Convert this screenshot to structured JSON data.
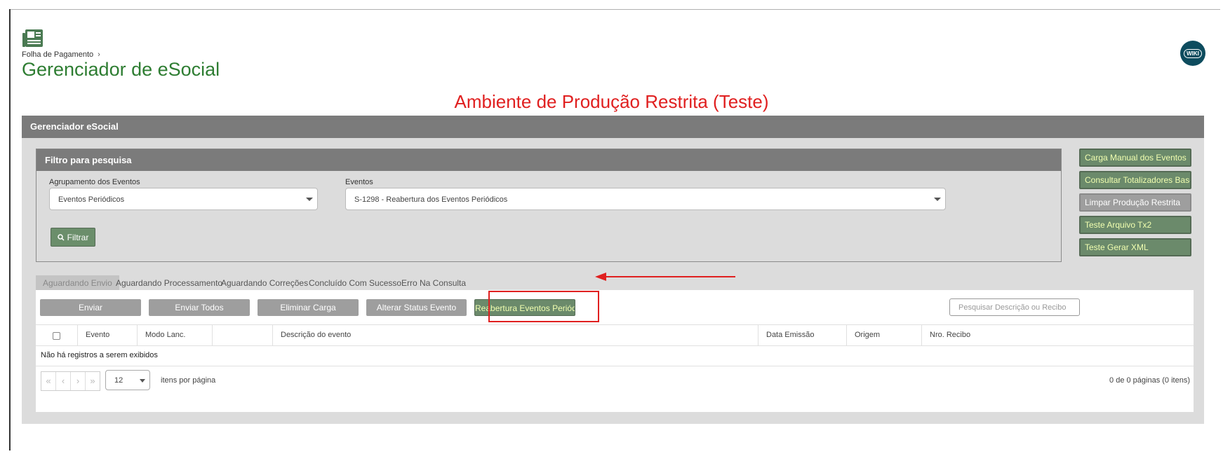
{
  "breadcrumb": {
    "parent": "Folha de Pagamento",
    "sep": "›"
  },
  "page_title": "Gerenciador de eSocial",
  "wiki_label": "WIKI",
  "environment_banner": "Ambiente de Produção Restrita (Teste)",
  "panel_title": "Gerenciador eSocial",
  "filter": {
    "title": "Filtro para pesquisa",
    "group_label": "Agrupamento dos Eventos",
    "group_value": "Eventos Periódicos",
    "events_label": "Eventos",
    "events_value": "S-1298 - Reabertura dos Eventos Periódicos",
    "filter_button": "Filtrar"
  },
  "side_buttons": [
    "Carga Manual dos Eventos",
    "Consultar Totalizadores Base",
    "Limpar Produção Restrita",
    "Teste Arquivo Tx2",
    "Teste Gerar XML"
  ],
  "tabs": [
    "Aguardando Envio",
    "Aguardando Processamento",
    "Aguardando Correções",
    "Concluído Com Sucesso",
    "Erro Na Consulta"
  ],
  "actions": [
    "Enviar",
    "Enviar Todos",
    "Eliminar Carga",
    "Alterar Status Evento",
    "Reabertura Eventos Periódic"
  ],
  "search_placeholder": "Pesquisar Descrição ou Recibo",
  "columns": [
    "Evento",
    "Modo Lanc.",
    "",
    "Descrição do evento",
    "Data Emissão",
    "Origem",
    "Nro. Recibo"
  ],
  "empty_message": "Não há registros a serem exibidos",
  "pager": {
    "nav": [
      "«",
      "‹",
      "›",
      "»"
    ],
    "page_size": "12",
    "items_per_page": "itens por página",
    "info": "0 de 0 páginas (0 itens)"
  },
  "colors": {
    "title_green": "#2e7d32",
    "banner_red": "#e02020",
    "header_grey": "#7b7b7b",
    "button_green": "#6b8a6b"
  }
}
